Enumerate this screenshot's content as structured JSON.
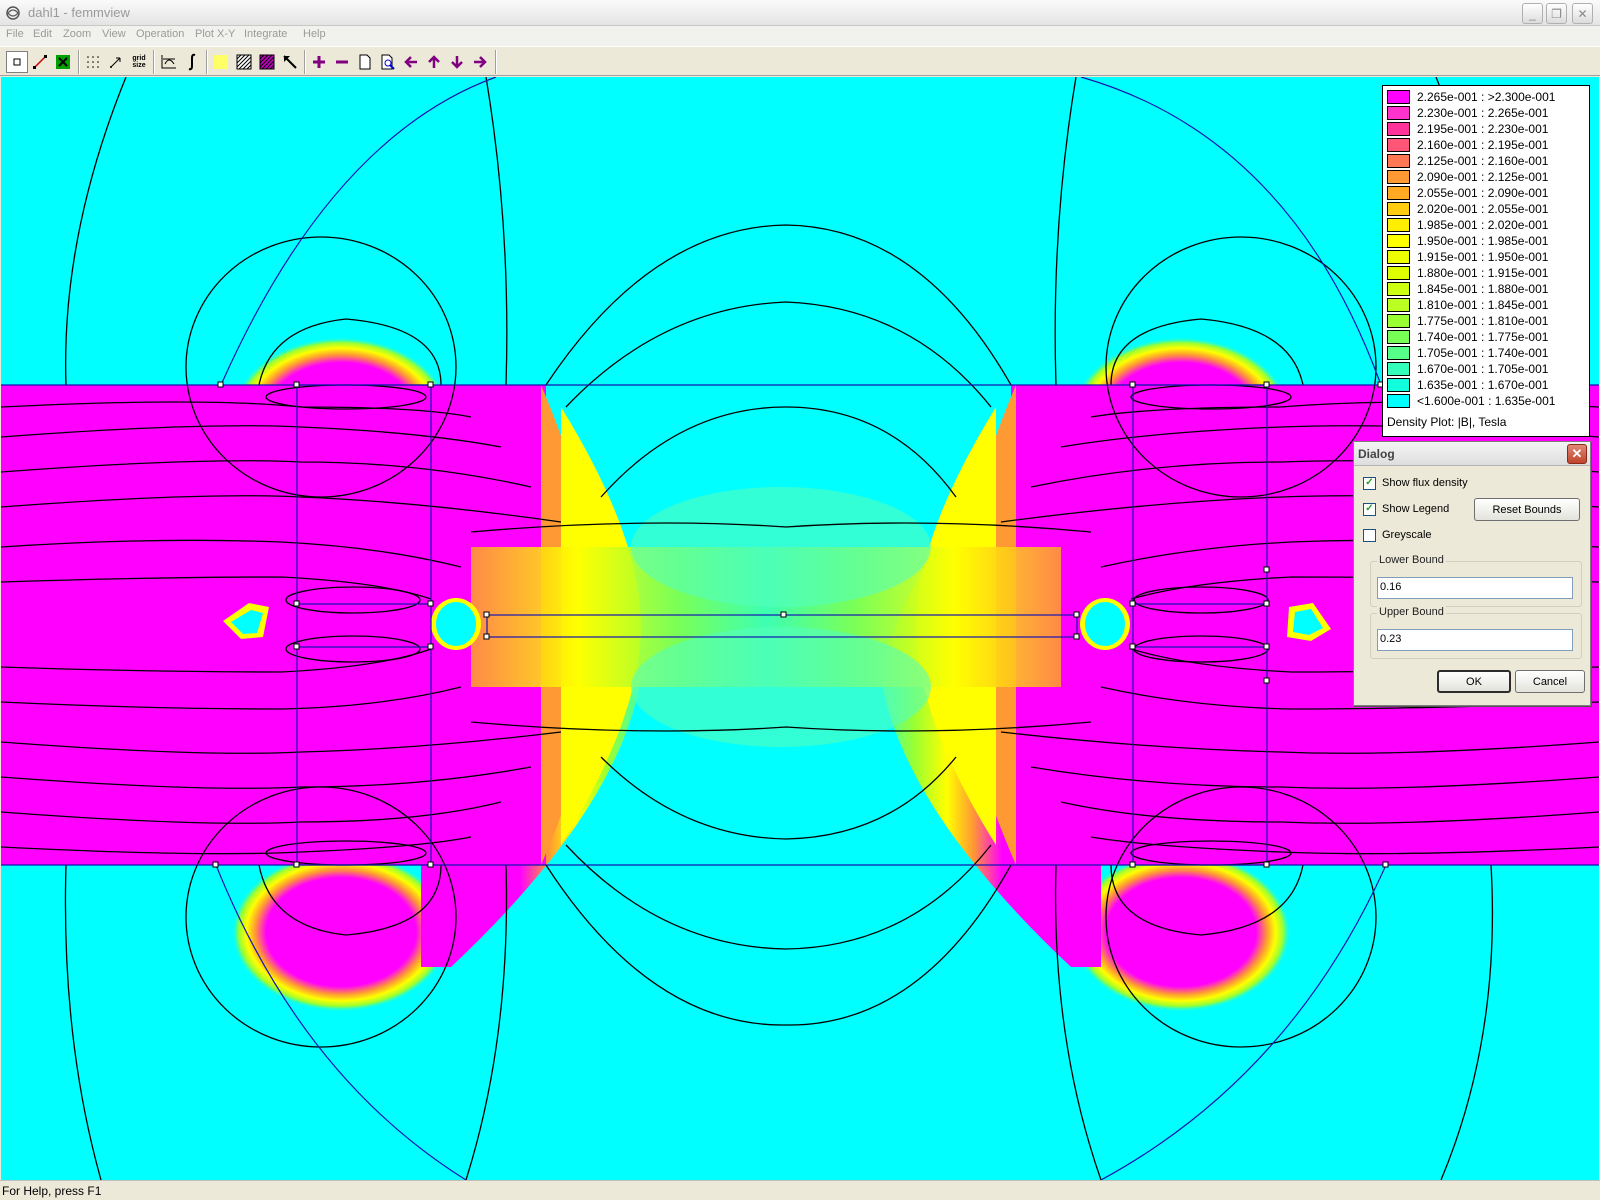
{
  "window": {
    "title": "dahl1 - femmview",
    "minimize": "_",
    "maximize": "❐",
    "close": "✕"
  },
  "menu": [
    "File",
    "Edit",
    "Zoom",
    "View",
    "Operation",
    "Plot X-Y",
    "Integrate",
    "Help"
  ],
  "toolbar": {
    "grid_size_label_1": "grid",
    "grid_size_label_2": "size",
    "tools": [
      "point-mode",
      "contour-mode",
      "area-mode",
      "show-grid",
      "snap-grid",
      "grid-size",
      "plot-xy",
      "integrate",
      "density-plot",
      "hatch-area",
      "highlight-area",
      "select-arrow",
      "zoom-in",
      "zoom-out",
      "zoom-page",
      "zoom-window",
      "pan-left",
      "pan-up",
      "pan-down",
      "pan-right"
    ]
  },
  "legend": {
    "title": "Density Plot: |B|, Tesla",
    "rows": [
      {
        "label": "2.265e-001 : >2.300e-001",
        "color": "#ff00ff"
      },
      {
        "label": "2.230e-001 : 2.265e-001",
        "color": "#ff33cc"
      },
      {
        "label": "2.195e-001 : 2.230e-001",
        "color": "#ff3399"
      },
      {
        "label": "2.160e-001 : 2.195e-001",
        "color": "#ff5577"
      },
      {
        "label": "2.125e-001 : 2.160e-001",
        "color": "#ff7755"
      },
      {
        "label": "2.090e-001 : 2.125e-001",
        "color": "#ff9933"
      },
      {
        "label": "2.055e-001 : 2.090e-001",
        "color": "#ffaa22"
      },
      {
        "label": "2.020e-001 : 2.055e-001",
        "color": "#ffcc11"
      },
      {
        "label": "1.985e-001 : 2.020e-001",
        "color": "#ffee00"
      },
      {
        "label": "1.950e-001 : 1.985e-001",
        "color": "#ffff00"
      },
      {
        "label": "1.915e-001 : 1.950e-001",
        "color": "#eeff00"
      },
      {
        "label": "1.880e-001 : 1.915e-001",
        "color": "#ddff00"
      },
      {
        "label": "1.845e-001 : 1.880e-001",
        "color": "#ccff11"
      },
      {
        "label": "1.810e-001 : 1.845e-001",
        "color": "#bbff22"
      },
      {
        "label": "1.775e-001 : 1.810e-001",
        "color": "#99ff33"
      },
      {
        "label": "1.740e-001 : 1.775e-001",
        "color": "#77ff55"
      },
      {
        "label": "1.705e-001 : 1.740e-001",
        "color": "#55ff88"
      },
      {
        "label": "1.670e-001 : 1.705e-001",
        "color": "#33ffbb"
      },
      {
        "label": "1.635e-001 : 1.670e-001",
        "color": "#11ffdd"
      },
      {
        "label": "<1.600e-001 : 1.635e-001",
        "color": "#00ffff"
      }
    ]
  },
  "dialog": {
    "title": "Dialog",
    "close": "✕",
    "show_flux_density": {
      "label": "Show flux density",
      "checked": true
    },
    "show_legend": {
      "label": "Show Legend",
      "checked": true
    },
    "greyscale": {
      "label": "Greyscale",
      "checked": false
    },
    "reset_bounds": "Reset Bounds",
    "lower_bound": {
      "label": "Lower Bound",
      "value": "0.16"
    },
    "upper_bound": {
      "label": "Upper Bound",
      "value": "0.23"
    },
    "ok": "OK",
    "cancel": "Cancel"
  },
  "status": {
    "text": "For Help, press F1"
  },
  "colors": {
    "background_low": "#00ffff",
    "high_field": "#ff00ff",
    "mid_field": "#ffff00",
    "flux_lines": "#000000",
    "geometry": "#0000cc"
  }
}
